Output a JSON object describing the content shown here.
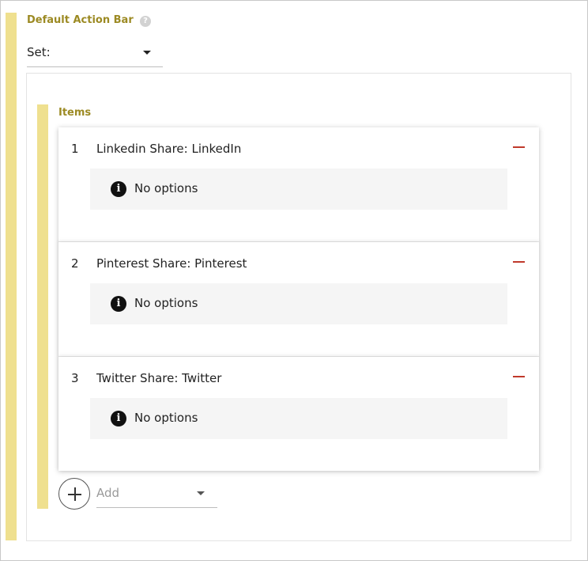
{
  "field": {
    "title": "Default Action Bar",
    "help_icon": "question-circle-icon",
    "help_glyph": "?"
  },
  "set_select": {
    "value": "Set:"
  },
  "items_section": {
    "title": "Items",
    "items": [
      {
        "index": "1",
        "label": "Linkedin Share: LinkedIn",
        "options_text": "No options"
      },
      {
        "index": "2",
        "label": "Pinterest Share: Pinterest",
        "options_text": "No options"
      },
      {
        "index": "3",
        "label": "Twitter Share: Twitter",
        "options_text": "No options"
      }
    ],
    "info_glyph": "i"
  },
  "add": {
    "placeholder": "Add"
  },
  "colors": {
    "accent_bar": "#efe08f",
    "title_text": "#9c8a23",
    "remove": "#c0392b"
  }
}
